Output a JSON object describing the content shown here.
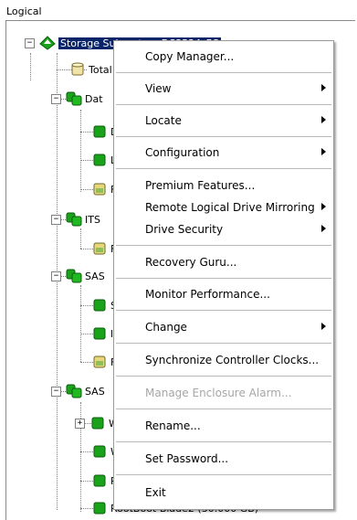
{
  "panel": {
    "title": "Logical"
  },
  "tree": {
    "root_label": "Storage Subsystem DS3524_FC",
    "nodes": [
      {
        "label": "Total"
      },
      {
        "label": "Dat"
      },
      {
        "label": "D"
      },
      {
        "label": "LU"
      },
      {
        "label": "Fr"
      },
      {
        "label": "ITS"
      },
      {
        "label": "Fr"
      },
      {
        "label": "SAS"
      },
      {
        "label": "S"
      },
      {
        "label": "lin"
      },
      {
        "label": "Fr"
      },
      {
        "label": "SAS"
      },
      {
        "label": "W"
      },
      {
        "label": "W"
      },
      {
        "label": "R"
      },
      {
        "label": "RootBoot-Blade2 (30.000 GB)"
      }
    ]
  },
  "context_menu": {
    "items": [
      {
        "label": "Copy Manager...",
        "submenu": false
      },
      {
        "label": "View",
        "submenu": true
      },
      {
        "label": "Locate",
        "submenu": true
      },
      {
        "label": "Configuration",
        "submenu": true
      },
      {
        "label": "Premium Features...",
        "submenu": false
      },
      {
        "label": "Remote Logical Drive Mirroring",
        "submenu": true
      },
      {
        "label": "Drive Security",
        "submenu": true
      },
      {
        "label": "Recovery Guru...",
        "submenu": false
      },
      {
        "label": "Monitor Performance...",
        "submenu": false
      },
      {
        "label": "Change",
        "submenu": true
      },
      {
        "label": "Synchronize Controller Clocks...",
        "submenu": false
      },
      {
        "label": "Manage Enclosure Alarm...",
        "submenu": false,
        "disabled": true
      },
      {
        "label": "Rename...",
        "submenu": false
      },
      {
        "label": "Set Password...",
        "submenu": false
      },
      {
        "label": "Exit",
        "submenu": false
      }
    ]
  },
  "icons": {
    "root": "storage-subsystem-icon",
    "group": "array-group-icon",
    "drive": "logical-drive-icon",
    "free": "free-capacity-icon",
    "total": "total-capacity-icon"
  },
  "colors": {
    "selection": "#0a246a",
    "drive_green": "#1aa31a",
    "free_yellow": "#e8d77a"
  }
}
